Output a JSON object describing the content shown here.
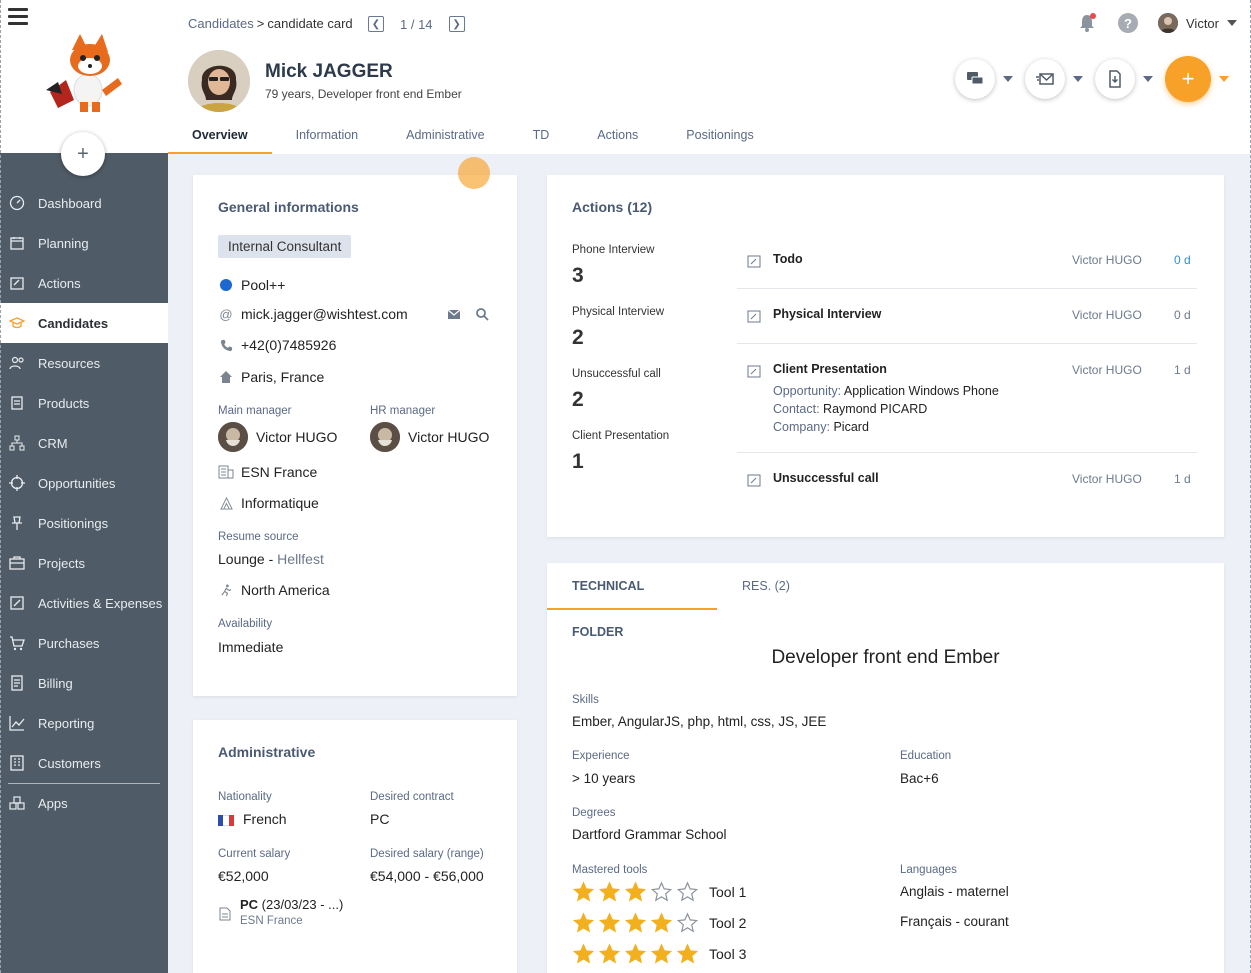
{
  "sidebar": {
    "items": [
      {
        "label": "Dashboard",
        "icon": "dashboard-icon"
      },
      {
        "label": "Planning",
        "icon": "calendar-icon"
      },
      {
        "label": "Actions",
        "icon": "actions-icon"
      },
      {
        "label": "Candidates",
        "icon": "graduation-cap-icon"
      },
      {
        "label": "Resources",
        "icon": "people-icon"
      },
      {
        "label": "Products",
        "icon": "products-icon"
      },
      {
        "label": "CRM",
        "icon": "crm-icon"
      },
      {
        "label": "Opportunities",
        "icon": "target-icon"
      },
      {
        "label": "Positionings",
        "icon": "pin-icon"
      },
      {
        "label": "Projects",
        "icon": "briefcase-icon"
      },
      {
        "label": "Activities & Expenses",
        "icon": "edit-icon"
      },
      {
        "label": "Purchases",
        "icon": "cart-icon"
      },
      {
        "label": "Billing",
        "icon": "invoice-icon"
      },
      {
        "label": "Reporting",
        "icon": "chart-icon"
      },
      {
        "label": "Customers",
        "icon": "building-icon"
      },
      {
        "label": "Apps",
        "icon": "apps-icon"
      }
    ],
    "add_label": "+"
  },
  "header": {
    "breadcrumb_root": "Candidates",
    "breadcrumb_sep": ">",
    "breadcrumb_current": "candidate card",
    "pager": "1 / 14",
    "user_name": "Victor",
    "help_label": "?",
    "candidate_name": "Mick JAGGER",
    "candidate_subtitle": "79 years, Developer front end Ember",
    "add_label": "+",
    "tabs": [
      "Overview",
      "Information",
      "Administrative",
      "TD",
      "Actions",
      "Positionings"
    ]
  },
  "general": {
    "title": "General informations",
    "type_chip": "Internal Consultant",
    "pool": "Pool++",
    "email": "mick.jagger@wishtest.com",
    "phone": "+42(0)7485926",
    "location": "Paris, France",
    "main_manager_label": "Main manager",
    "main_manager": "Victor HUGO",
    "hr_manager_label": "HR manager",
    "hr_manager": "Victor HUGO",
    "agency": "ESN France",
    "pole": "Informatique",
    "resume_source_label": "Resume source",
    "resume_source": "Lounge",
    "resume_source_dash": " - ",
    "resume_source_detail": "Hellfest",
    "mobility": "North America",
    "availability_label": "Availability",
    "availability": "Immediate"
  },
  "administrative": {
    "title": "Administrative",
    "nationality_label": "Nationality",
    "nationality": "French",
    "desired_contract_label": "Desired contract",
    "desired_contract": "PC",
    "current_salary_label": "Current salary",
    "current_salary": "€52,000",
    "desired_salary_label": "Desired salary (range)",
    "desired_salary": "€54,000 - €56,000",
    "contract_type": "PC",
    "contract_dates": " (23/03/23 - ...)",
    "contract_company": "ESN France"
  },
  "actions": {
    "title": "Actions (12)",
    "stats": [
      {
        "label": "Phone Interview",
        "count": "3"
      },
      {
        "label": "Physical Interview",
        "count": "2"
      },
      {
        "label": "Unsuccessful call",
        "count": "2"
      },
      {
        "label": "Client Presentation",
        "count": "1"
      }
    ],
    "list": [
      {
        "title": "Todo",
        "who": "Victor HUGO",
        "delay": "0 d"
      },
      {
        "title": "Physical Interview",
        "who": "Victor HUGO",
        "delay": "0 d"
      },
      {
        "title": "Client Presentation",
        "who": "Victor HUGO",
        "delay": "1 d",
        "opportunity_label": "Opportunity:",
        "opportunity": "Application Windows Phone",
        "contact_label": "Contact:",
        "contact": "Raymond PICARD",
        "company_label": "Company:",
        "company": "Picard"
      },
      {
        "title": "Unsuccessful call",
        "who": "Victor HUGO",
        "delay": "1 d"
      }
    ]
  },
  "technical": {
    "tabs": [
      "TECHNICAL FOLDER",
      "RES. (2)"
    ],
    "title": "Developer front end Ember",
    "skills_label": "Skills",
    "skills": "Ember, AngularJS, php, html, css, JS, JEE",
    "experience_label": "Experience",
    "experience": "> 10 years",
    "education_label": "Education",
    "education": "Bac+6",
    "degrees_label": "Degrees",
    "degrees": "Dartford Grammar School",
    "tools_label": "Mastered tools",
    "tools": [
      {
        "name": "Tool 1",
        "rating": 3
      },
      {
        "name": "Tool 2",
        "rating": 4
      },
      {
        "name": "Tool 3",
        "rating": 5
      }
    ],
    "languages_label": "Languages",
    "languages": [
      "Anglais - maternel",
      "Français - courant"
    ]
  },
  "colors": {
    "accent": "#f7a128",
    "sidebar": "#4f5b66",
    "star": "#f2b01e"
  }
}
